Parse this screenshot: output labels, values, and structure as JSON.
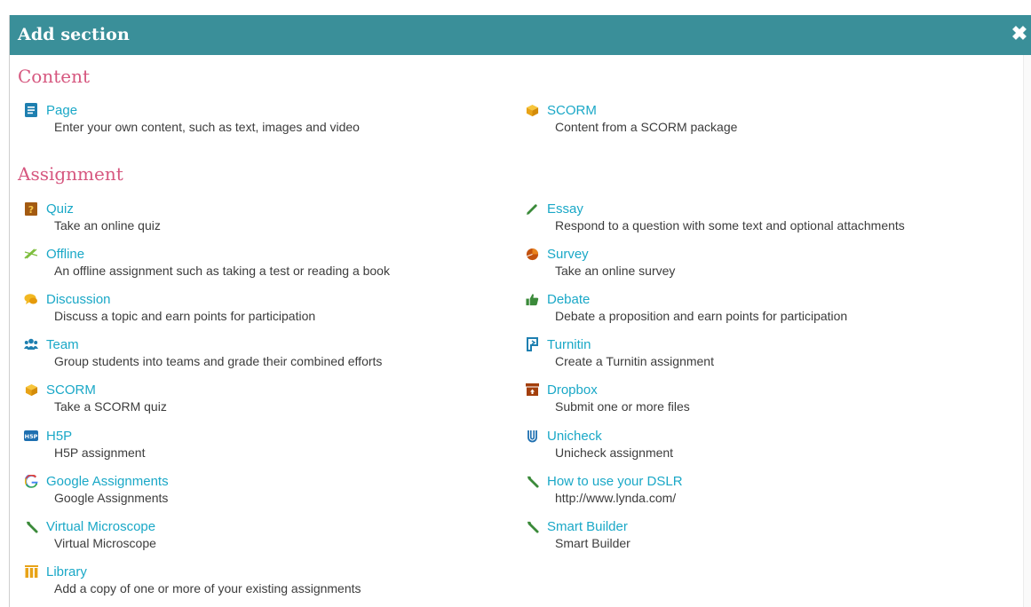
{
  "dialog": {
    "title": "Add section",
    "close_label": "✖"
  },
  "content": {
    "heading": "Content",
    "items": [
      {
        "label": "Page",
        "desc": "Enter your own content, such as text, images and video",
        "icon": "page-icon"
      },
      {
        "label": "SCORM",
        "desc": "Content from a SCORM package",
        "icon": "scorm-cube-icon"
      }
    ]
  },
  "assignment": {
    "heading": "Assignment",
    "left": [
      {
        "label": "Quiz",
        "desc": "Take an online quiz",
        "icon": "quiz-icon"
      },
      {
        "label": "Offline",
        "desc": "An offline assignment such as taking a test or reading a book",
        "icon": "offline-icon"
      },
      {
        "label": "Discussion",
        "desc": "Discuss a topic and earn points for participation",
        "icon": "discussion-icon"
      },
      {
        "label": "Team",
        "desc": "Group students into teams and grade their combined efforts",
        "icon": "team-icon"
      },
      {
        "label": "SCORM",
        "desc": "Take a SCORM quiz",
        "icon": "scorm-cube-icon"
      },
      {
        "label": "H5P",
        "desc": "H5P assignment",
        "icon": "h5p-icon"
      },
      {
        "label": "Google Assignments",
        "desc": "Google Assignments",
        "icon": "google-icon"
      },
      {
        "label": "Virtual Microscope",
        "desc": "Virtual Microscope",
        "icon": "wrench-icon"
      },
      {
        "label": "Library",
        "desc": "Add a copy of one or more of your existing assignments",
        "icon": "library-icon"
      }
    ],
    "right": [
      {
        "label": "Essay",
        "desc": "Respond to a question with some text and optional attachments",
        "icon": "pencil-icon"
      },
      {
        "label": "Survey",
        "desc": "Take an online survey",
        "icon": "survey-icon"
      },
      {
        "label": "Debate",
        "desc": "Debate a proposition and earn points for participation",
        "icon": "thumbs-up-icon"
      },
      {
        "label": "Turnitin",
        "desc": "Create a Turnitin assignment",
        "icon": "turnitin-icon"
      },
      {
        "label": "Dropbox",
        "desc": "Submit one or more files",
        "icon": "dropbox-icon"
      },
      {
        "label": "Unicheck",
        "desc": "Unicheck assignment",
        "icon": "unicheck-icon"
      },
      {
        "label": "How to use your DSLR",
        "desc": "http://www.lynda.com/",
        "icon": "wrench-icon"
      },
      {
        "label": "Smart Builder",
        "desc": "Smart Builder",
        "icon": "wrench-icon"
      }
    ]
  }
}
